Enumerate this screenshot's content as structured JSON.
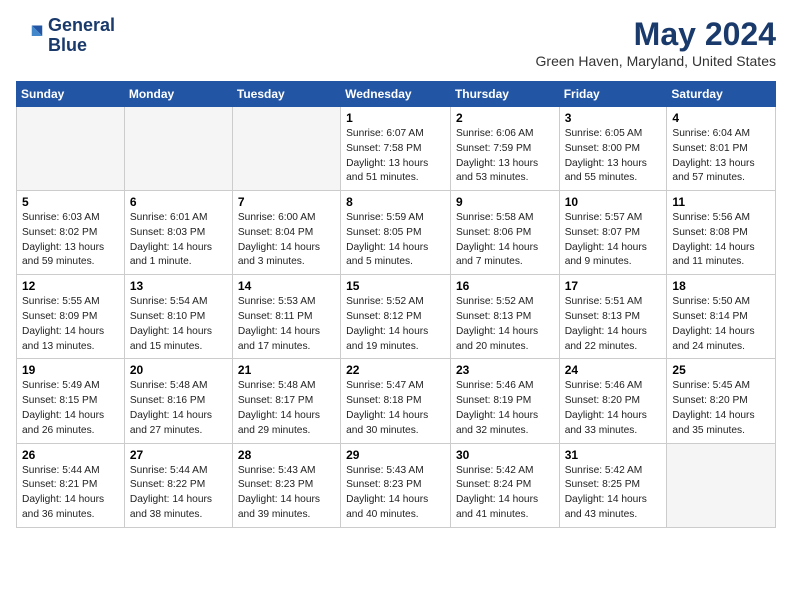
{
  "header": {
    "logo_line1": "General",
    "logo_line2": "Blue",
    "month": "May 2024",
    "location": "Green Haven, Maryland, United States"
  },
  "weekdays": [
    "Sunday",
    "Monday",
    "Tuesday",
    "Wednesday",
    "Thursday",
    "Friday",
    "Saturday"
  ],
  "weeks": [
    [
      {
        "day": "",
        "info": ""
      },
      {
        "day": "",
        "info": ""
      },
      {
        "day": "",
        "info": ""
      },
      {
        "day": "1",
        "info": "Sunrise: 6:07 AM\nSunset: 7:58 PM\nDaylight: 13 hours\nand 51 minutes."
      },
      {
        "day": "2",
        "info": "Sunrise: 6:06 AM\nSunset: 7:59 PM\nDaylight: 13 hours\nand 53 minutes."
      },
      {
        "day": "3",
        "info": "Sunrise: 6:05 AM\nSunset: 8:00 PM\nDaylight: 13 hours\nand 55 minutes."
      },
      {
        "day": "4",
        "info": "Sunrise: 6:04 AM\nSunset: 8:01 PM\nDaylight: 13 hours\nand 57 minutes."
      }
    ],
    [
      {
        "day": "5",
        "info": "Sunrise: 6:03 AM\nSunset: 8:02 PM\nDaylight: 13 hours\nand 59 minutes."
      },
      {
        "day": "6",
        "info": "Sunrise: 6:01 AM\nSunset: 8:03 PM\nDaylight: 14 hours\nand 1 minute."
      },
      {
        "day": "7",
        "info": "Sunrise: 6:00 AM\nSunset: 8:04 PM\nDaylight: 14 hours\nand 3 minutes."
      },
      {
        "day": "8",
        "info": "Sunrise: 5:59 AM\nSunset: 8:05 PM\nDaylight: 14 hours\nand 5 minutes."
      },
      {
        "day": "9",
        "info": "Sunrise: 5:58 AM\nSunset: 8:06 PM\nDaylight: 14 hours\nand 7 minutes."
      },
      {
        "day": "10",
        "info": "Sunrise: 5:57 AM\nSunset: 8:07 PM\nDaylight: 14 hours\nand 9 minutes."
      },
      {
        "day": "11",
        "info": "Sunrise: 5:56 AM\nSunset: 8:08 PM\nDaylight: 14 hours\nand 11 minutes."
      }
    ],
    [
      {
        "day": "12",
        "info": "Sunrise: 5:55 AM\nSunset: 8:09 PM\nDaylight: 14 hours\nand 13 minutes."
      },
      {
        "day": "13",
        "info": "Sunrise: 5:54 AM\nSunset: 8:10 PM\nDaylight: 14 hours\nand 15 minutes."
      },
      {
        "day": "14",
        "info": "Sunrise: 5:53 AM\nSunset: 8:11 PM\nDaylight: 14 hours\nand 17 minutes."
      },
      {
        "day": "15",
        "info": "Sunrise: 5:52 AM\nSunset: 8:12 PM\nDaylight: 14 hours\nand 19 minutes."
      },
      {
        "day": "16",
        "info": "Sunrise: 5:52 AM\nSunset: 8:13 PM\nDaylight: 14 hours\nand 20 minutes."
      },
      {
        "day": "17",
        "info": "Sunrise: 5:51 AM\nSunset: 8:13 PM\nDaylight: 14 hours\nand 22 minutes."
      },
      {
        "day": "18",
        "info": "Sunrise: 5:50 AM\nSunset: 8:14 PM\nDaylight: 14 hours\nand 24 minutes."
      }
    ],
    [
      {
        "day": "19",
        "info": "Sunrise: 5:49 AM\nSunset: 8:15 PM\nDaylight: 14 hours\nand 26 minutes."
      },
      {
        "day": "20",
        "info": "Sunrise: 5:48 AM\nSunset: 8:16 PM\nDaylight: 14 hours\nand 27 minutes."
      },
      {
        "day": "21",
        "info": "Sunrise: 5:48 AM\nSunset: 8:17 PM\nDaylight: 14 hours\nand 29 minutes."
      },
      {
        "day": "22",
        "info": "Sunrise: 5:47 AM\nSunset: 8:18 PM\nDaylight: 14 hours\nand 30 minutes."
      },
      {
        "day": "23",
        "info": "Sunrise: 5:46 AM\nSunset: 8:19 PM\nDaylight: 14 hours\nand 32 minutes."
      },
      {
        "day": "24",
        "info": "Sunrise: 5:46 AM\nSunset: 8:20 PM\nDaylight: 14 hours\nand 33 minutes."
      },
      {
        "day": "25",
        "info": "Sunrise: 5:45 AM\nSunset: 8:20 PM\nDaylight: 14 hours\nand 35 minutes."
      }
    ],
    [
      {
        "day": "26",
        "info": "Sunrise: 5:44 AM\nSunset: 8:21 PM\nDaylight: 14 hours\nand 36 minutes."
      },
      {
        "day": "27",
        "info": "Sunrise: 5:44 AM\nSunset: 8:22 PM\nDaylight: 14 hours\nand 38 minutes."
      },
      {
        "day": "28",
        "info": "Sunrise: 5:43 AM\nSunset: 8:23 PM\nDaylight: 14 hours\nand 39 minutes."
      },
      {
        "day": "29",
        "info": "Sunrise: 5:43 AM\nSunset: 8:23 PM\nDaylight: 14 hours\nand 40 minutes."
      },
      {
        "day": "30",
        "info": "Sunrise: 5:42 AM\nSunset: 8:24 PM\nDaylight: 14 hours\nand 41 minutes."
      },
      {
        "day": "31",
        "info": "Sunrise: 5:42 AM\nSunset: 8:25 PM\nDaylight: 14 hours\nand 43 minutes."
      },
      {
        "day": "",
        "info": ""
      }
    ]
  ]
}
